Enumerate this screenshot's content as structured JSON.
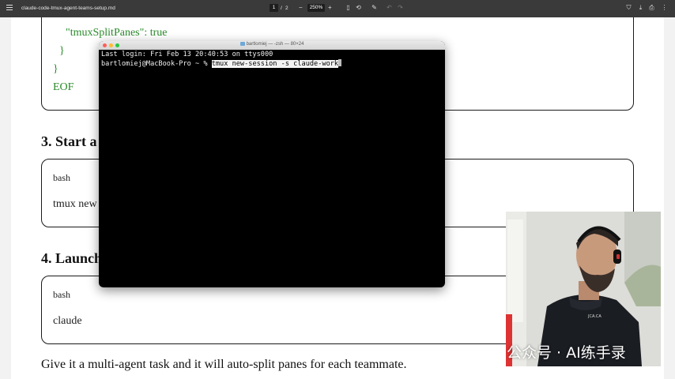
{
  "toolbar": {
    "document_title": "claude-code-tmux-agent-teams-setup.md",
    "current_page": "1",
    "page_separator": "/",
    "total_pages": "2",
    "zoom_out": "−",
    "zoom_level": "250%",
    "zoom_in": "+"
  },
  "document": {
    "code_tail": [
      "\"tmuxSplitPanes\": true",
      "}",
      "}",
      "EOF"
    ],
    "section3_heading": "3. Start a",
    "section3_box": {
      "lang": "bash",
      "command": "tmux new"
    },
    "section4_heading": "4. Launch",
    "section4_box": {
      "lang": "bash",
      "command": "claude"
    },
    "closing_paragraph": "Give it a multi-agent task and it will auto-split panes for each teammate."
  },
  "terminal": {
    "title": "bartlomiej — -zsh — 80×24",
    "last_login": "Last login: Fri Feb 13 20:40:53 on ttys000",
    "prompt": "bartlomiej@MacBook-Pro ~ % ",
    "command": "tmux new-session -s claude-work"
  },
  "webcam": {
    "shirt_text": "JCA.CA"
  },
  "watermark": {
    "text": "公众号 · AI练手录"
  }
}
